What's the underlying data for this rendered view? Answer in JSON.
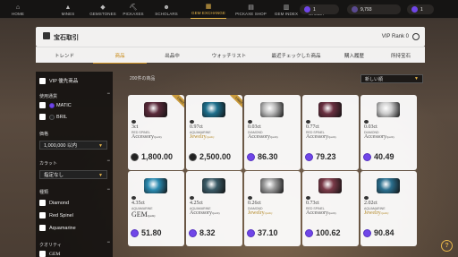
{
  "nav": {
    "items": [
      {
        "label": "HOME",
        "icon": "home-icon",
        "glyph": "⌂"
      },
      {
        "label": "MINES",
        "icon": "mine-icon",
        "glyph": "▲"
      },
      {
        "label": "GEMSTONES",
        "icon": "gem-icon",
        "glyph": "◆"
      },
      {
        "label": "PICKAXES",
        "icon": "pickaxe-icon",
        "glyph": "⛏"
      },
      {
        "label": "SCHOLARS",
        "icon": "scholar-icon",
        "glyph": "☻"
      },
      {
        "label": "GEM EXCHANGE",
        "icon": "exchange-icon",
        "glyph": "▦"
      },
      {
        "label": "PICKAXE SHOP",
        "icon": "shop-icon",
        "glyph": "▤"
      },
      {
        "label": "GEM INDEX",
        "icon": "index-icon",
        "glyph": "▥"
      },
      {
        "label": "WALLET",
        "icon": "wallet-icon",
        "glyph": "▭"
      }
    ],
    "active_index": 5,
    "balances": [
      {
        "value": "1"
      },
      {
        "value": "9,793"
      },
      {
        "value": "1"
      }
    ]
  },
  "header": {
    "title": "宝石取引",
    "vip": "VIP Rank 0"
  },
  "tabs": [
    "トレンド",
    "商品",
    "出品中",
    "ウォッチリスト",
    "最近チェックした商品",
    "購入履歴",
    "所持宝石"
  ],
  "active_tab": 1,
  "sidebar": {
    "vip_label": "VIP 優先商品",
    "currency_head": "使用通貨",
    "currencies": [
      "MATIC",
      "BRIL"
    ],
    "price_head": "価格",
    "price_value": "1,000,000 以内",
    "carat_head": "カラット",
    "carat_value": "指定なし",
    "type_head": "種類",
    "types": [
      "Diamond",
      "Red Spinel",
      "Aquamarine"
    ],
    "quality_head": "クオリティ",
    "quality_first": "GEM"
  },
  "results": {
    "count": "200件の商品",
    "sort": "新しい順"
  },
  "cards": [
    {
      "carat": "3ct",
      "name": "RED SPINEL",
      "quality": "Accessory",
      "qclass": "",
      "price": "1,800.00",
      "coin": "dark",
      "listed": true,
      "gem": "#5a2a3a"
    },
    {
      "carat": "0.97ct",
      "name": "AQUAMARINE",
      "quality": "Jewelry",
      "qclass": "jewelry",
      "price": "2,500.00",
      "coin": "dark",
      "listed": true,
      "gem": "#1e6f8c"
    },
    {
      "carat": "0.03ct",
      "name": "DIAMOND",
      "quality": "Accessory",
      "qclass": "",
      "price": "86.30",
      "coin": "purple",
      "listed": false,
      "gem": "#bbbbbb"
    },
    {
      "carat": "0.77ct",
      "name": "RED SPINEL",
      "quality": "Accessory",
      "qclass": "",
      "price": "79.23",
      "coin": "purple",
      "listed": false,
      "gem": "#6a3040"
    },
    {
      "carat": "0.03ct",
      "name": "DIAMOND",
      "quality": "Accessory",
      "qclass": "",
      "price": "40.49",
      "coin": "purple",
      "listed": false,
      "gem": "#cccccc"
    },
    {
      "carat": "4.35ct",
      "name": "AQUAMARINE",
      "quality": "GEM",
      "qclass": "gem",
      "price": "51.80",
      "coin": "purple",
      "listed": false,
      "gem": "#2a8ab0"
    },
    {
      "carat": "4.25ct",
      "name": "AQUAMARINE",
      "quality": "Accessory",
      "qclass": "",
      "price": "8.32",
      "coin": "purple",
      "listed": false,
      "gem": "#3a5a66"
    },
    {
      "carat": "0.26ct",
      "name": "DIAMOND",
      "quality": "Jewelry",
      "qclass": "jewelry",
      "price": "37.10",
      "coin": "purple",
      "listed": false,
      "gem": "#999999"
    },
    {
      "carat": "0.73ct",
      "name": "RED SPINEL",
      "quality": "Accessory",
      "qclass": "",
      "price": "100.62",
      "coin": "purple",
      "listed": false,
      "gem": "#7a3a48"
    },
    {
      "carat": "2.02ct",
      "name": "AQUAMARINE",
      "quality": "Jewelry",
      "qclass": "jewelry",
      "price": "90.84",
      "coin": "purple",
      "listed": false,
      "gem": "#2b6f8e"
    }
  ],
  "listed_label": "Listed",
  "quality_suffix": "Quality",
  "help_label": "?"
}
